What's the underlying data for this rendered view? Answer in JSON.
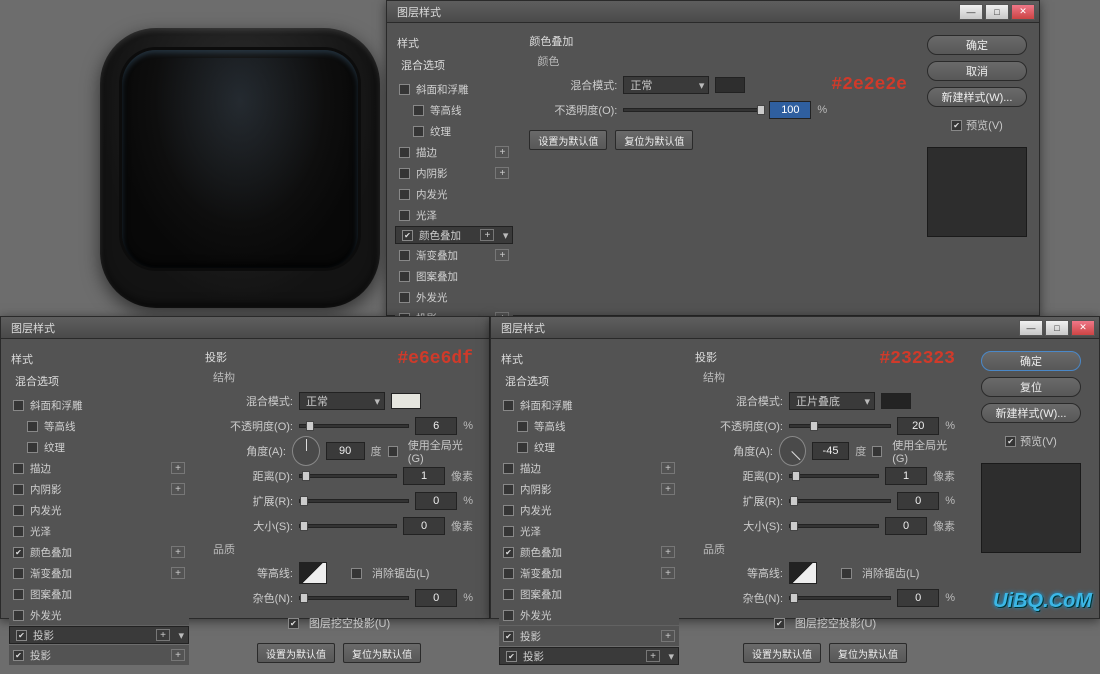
{
  "titles": {
    "layer_style": "图层样式"
  },
  "common": {
    "styles_heading": "样式",
    "blend_options": "混合选项",
    "set_default": "设置为默认值",
    "reset_default": "复位为默认值",
    "ok": "确定",
    "cancel": "取消",
    "reset": "复位",
    "new_style": "新建样式(W)...",
    "preview": "预览(V)",
    "blend_mode": "混合模式:",
    "opacity": "不透明度(O):",
    "angle": "角度(A):",
    "use_global": "使用全局光(G)",
    "distance": "距离(D):",
    "spread": "扩展(R):",
    "size": "大小(S):",
    "quality": "品质",
    "contour": "等高线:",
    "anti_alias": "消除锯齿(L)",
    "noise": "杂色(N):",
    "knockout": "图层挖空投影(U)",
    "structure": "结构",
    "color": "颜色",
    "percent": "%",
    "degree": "度",
    "px": "像素"
  },
  "style_items": [
    {
      "label": "斜面和浮雕",
      "checked": false,
      "fx": false
    },
    {
      "label": "等高线",
      "checked": false,
      "fx": false,
      "indent": true
    },
    {
      "label": "纹理",
      "checked": false,
      "fx": false,
      "indent": true
    },
    {
      "label": "描边",
      "checked": false,
      "fx": true
    },
    {
      "label": "内阴影",
      "checked": false,
      "fx": true
    },
    {
      "label": "内发光",
      "checked": false,
      "fx": false
    },
    {
      "label": "光泽",
      "checked": false,
      "fx": false
    },
    {
      "label": "颜色叠加",
      "checked": true,
      "fx": true
    },
    {
      "label": "渐变叠加",
      "checked": false,
      "fx": true
    },
    {
      "label": "图案叠加",
      "checked": false,
      "fx": false
    },
    {
      "label": "外发光",
      "checked": false,
      "fx": false
    },
    {
      "label": "投影",
      "checked": true,
      "fx": true
    }
  ],
  "panel_top": {
    "section": "颜色叠加",
    "hex": "#2e2e2e",
    "blend_mode_val": "正常",
    "opacity_val": "100",
    "swatch": "#2e2e2e",
    "selected_idx": 7
  },
  "panel_left": {
    "section": "投影",
    "hex": "#e6e6df",
    "blend_mode_val": "正常",
    "opacity_val": "6",
    "angle_val": "90",
    "distance_val": "1",
    "spread_val": "0",
    "size_val": "0",
    "noise_val": "0",
    "swatch": "#e6e6df",
    "selected_idx": 11
  },
  "panel_right": {
    "section": "投影",
    "hex": "#232323",
    "blend_mode_val": "正片叠底",
    "opacity_val": "20",
    "angle_val": "-45",
    "distance_val": "1",
    "spread_val": "0",
    "size_val": "0",
    "noise_val": "0",
    "swatch": "#232323",
    "selected_idx": 12
  },
  "panel_left_styles_extra": {
    "label": "投影",
    "checked": true,
    "fx": true
  },
  "watermark": "UiBQ.CoM"
}
